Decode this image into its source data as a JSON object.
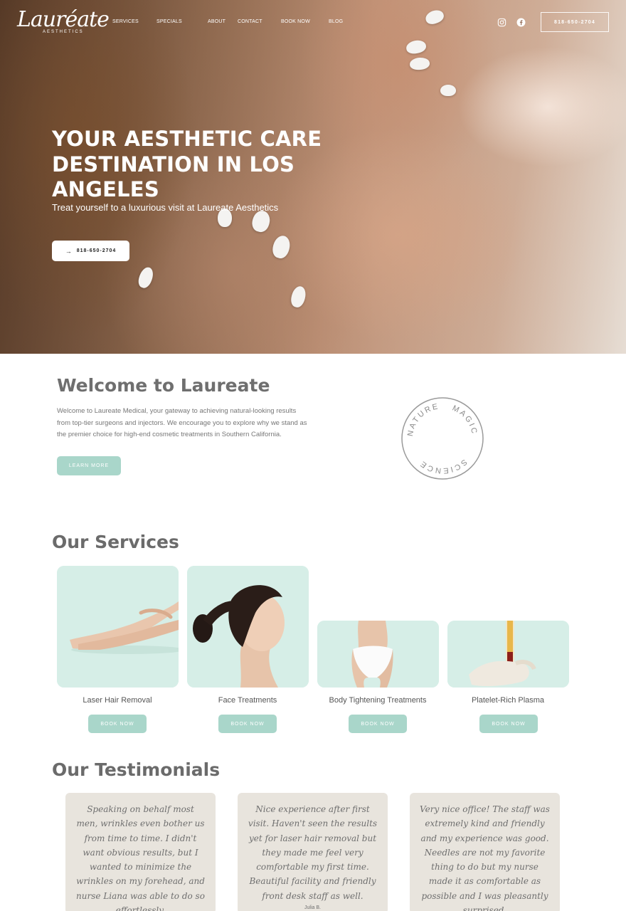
{
  "header": {
    "logo_script": "Lauréate",
    "logo_sub": "AESTHETICS",
    "nav": [
      "SERVICES",
      "SPECIALS",
      "ABOUT",
      "CONTACT",
      "BOOK NOW",
      "BLOG"
    ],
    "social_icons": [
      "instagram-icon",
      "facebook-icon"
    ],
    "phone": "818-650-2704"
  },
  "hero": {
    "title": "YOUR AESTHETIC CARE DESTINATION IN LOS ANGELES",
    "subtitle": "Treat yourself to a luxurious visit at Laureate Aesthetics",
    "cta": "818-650-2704"
  },
  "welcome": {
    "title": "Welcome to Laureate",
    "text": "Welcome to Laureate Medical, your gateway to achieving natural-looking results from top-tier surgeons and injectors. We encourage you to explore why we stand as the premier choice for high-end cosmetic treatments in Southern California.",
    "button": "LEARN MORE",
    "badge_words": [
      "NATURE",
      "MAGIC",
      "SCIENCE"
    ]
  },
  "services": {
    "title": "Our Services",
    "items": [
      {
        "label": "Laser Hair Removal",
        "button": "BOOK NOW"
      },
      {
        "label": "Face Treatments",
        "button": "BOOK NOW"
      },
      {
        "label": "Body Tightening Treatments",
        "button": "BOOK NOW"
      },
      {
        "label": "Platelet-Rich Plasma",
        "button": "BOOK NOW"
      }
    ]
  },
  "testimonials": {
    "title": "Our Testimonials",
    "items": [
      {
        "text": "Speaking on behalf most men, wrinkles even bother us from time to time. I didn't want obvious results, but I wanted to minimize the wrinkles on my forehead, and nurse Liana was able to do so effortlessly.",
        "author": ""
      },
      {
        "text": "Nice experience after first visit. Haven't seen the results yet for laser hair removal but they made me feel very comfortable my first time. Beautiful facility and friendly front desk staff as well.",
        "author": "Julia B."
      },
      {
        "text": "Very nice office! The staff was extremely kind and friendly and my experience was good. Needles are not my favorite thing to do but my nurse made it as comfortable as possible and I was pleasantly surprised.",
        "author": ""
      }
    ]
  },
  "colors": {
    "accent": "#a9d6ca",
    "card_bg": "#d8efe8",
    "testimonial_bg": "#e8e4dd",
    "star": "#e8a13c"
  }
}
